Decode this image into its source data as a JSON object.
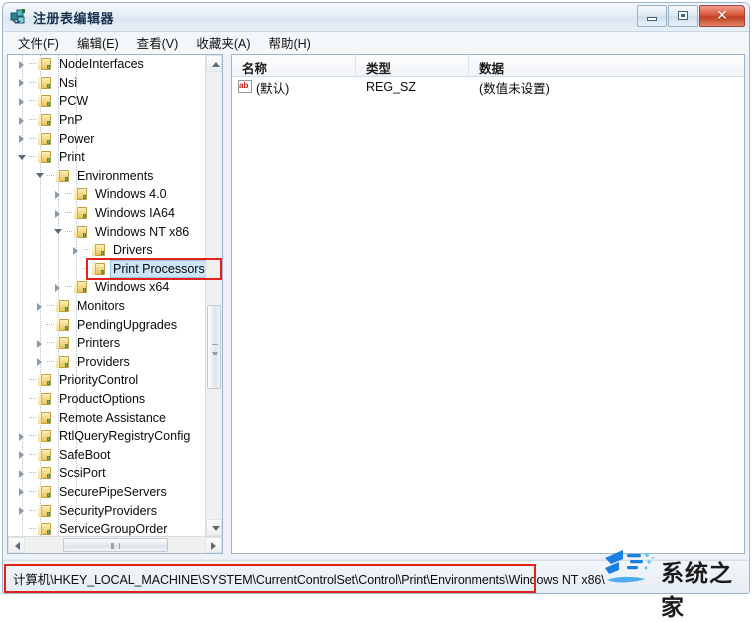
{
  "window": {
    "title": "注册表编辑器",
    "icon": "registry-editor-icon",
    "controls": {
      "minimize": "最小化",
      "maximize": "最大化",
      "close": "✕"
    }
  },
  "menu": {
    "items": [
      {
        "label": "文件(F)"
      },
      {
        "label": "编辑(E)"
      },
      {
        "label": "查看(V)"
      },
      {
        "label": "收藏夹(A)"
      },
      {
        "label": "帮助(H)"
      }
    ]
  },
  "tree": {
    "nodes": [
      {
        "label": "NodeInterfaces",
        "indent": 1,
        "state": "collapsed",
        "selected": false
      },
      {
        "label": "Nsi",
        "indent": 1,
        "state": "collapsed",
        "selected": false
      },
      {
        "label": "PCW",
        "indent": 1,
        "state": "collapsed",
        "selected": false
      },
      {
        "label": "PnP",
        "indent": 1,
        "state": "collapsed",
        "selected": false
      },
      {
        "label": "Power",
        "indent": 1,
        "state": "collapsed",
        "selected": false
      },
      {
        "label": "Print",
        "indent": 1,
        "state": "expanded",
        "selected": false
      },
      {
        "label": "Environments",
        "indent": 2,
        "state": "expanded",
        "selected": false
      },
      {
        "label": "Windows 4.0",
        "indent": 3,
        "state": "collapsed",
        "selected": false
      },
      {
        "label": "Windows IA64",
        "indent": 3,
        "state": "collapsed",
        "selected": false
      },
      {
        "label": "Windows NT x86",
        "indent": 3,
        "state": "expanded",
        "selected": false
      },
      {
        "label": "Drivers",
        "indent": 4,
        "state": "collapsed",
        "selected": false
      },
      {
        "label": "Print Processors",
        "indent": 4,
        "state": "leaf",
        "selected": true
      },
      {
        "label": "Windows x64",
        "indent": 3,
        "state": "collapsed",
        "selected": false
      },
      {
        "label": "Monitors",
        "indent": 2,
        "state": "collapsed",
        "selected": false
      },
      {
        "label": "PendingUpgrades",
        "indent": 2,
        "state": "leaf",
        "selected": false
      },
      {
        "label": "Printers",
        "indent": 2,
        "state": "collapsed",
        "selected": false
      },
      {
        "label": "Providers",
        "indent": 2,
        "state": "collapsed",
        "selected": false
      },
      {
        "label": "PriorityControl",
        "indent": 1,
        "state": "leaf",
        "selected": false
      },
      {
        "label": "ProductOptions",
        "indent": 1,
        "state": "leaf",
        "selected": false
      },
      {
        "label": "Remote Assistance",
        "indent": 1,
        "state": "leaf",
        "selected": false
      },
      {
        "label": "RtlQueryRegistryConfig",
        "indent": 1,
        "state": "collapsed",
        "selected": false
      },
      {
        "label": "SafeBoot",
        "indent": 1,
        "state": "collapsed",
        "selected": false
      },
      {
        "label": "ScsiPort",
        "indent": 1,
        "state": "collapsed",
        "selected": false
      },
      {
        "label": "SecurePipeServers",
        "indent": 1,
        "state": "collapsed",
        "selected": false
      },
      {
        "label": "SecurityProviders",
        "indent": 1,
        "state": "collapsed",
        "selected": false
      },
      {
        "label": "ServiceGroupOrder",
        "indent": 1,
        "state": "leaf",
        "selected": false
      }
    ]
  },
  "list": {
    "columns": [
      {
        "label": "名称"
      },
      {
        "label": "类型"
      },
      {
        "label": "数据"
      }
    ],
    "rows": [
      {
        "icon": "string-value-icon",
        "name": "(默认)",
        "type": "REG_SZ",
        "data": "(数值未设置)"
      }
    ]
  },
  "status": {
    "path": "计算机\\HKEY_LOCAL_MACHINE\\SYSTEM\\CurrentControlSet\\Control\\Print\\Environments\\Windows NT x86\\"
  },
  "watermark": {
    "text": "系统之家"
  },
  "colors": {
    "annotation": "#e2231a",
    "selection": "#cce4f7",
    "close_button": "#c1401f",
    "watermark_logo": "#1a7fe0"
  }
}
